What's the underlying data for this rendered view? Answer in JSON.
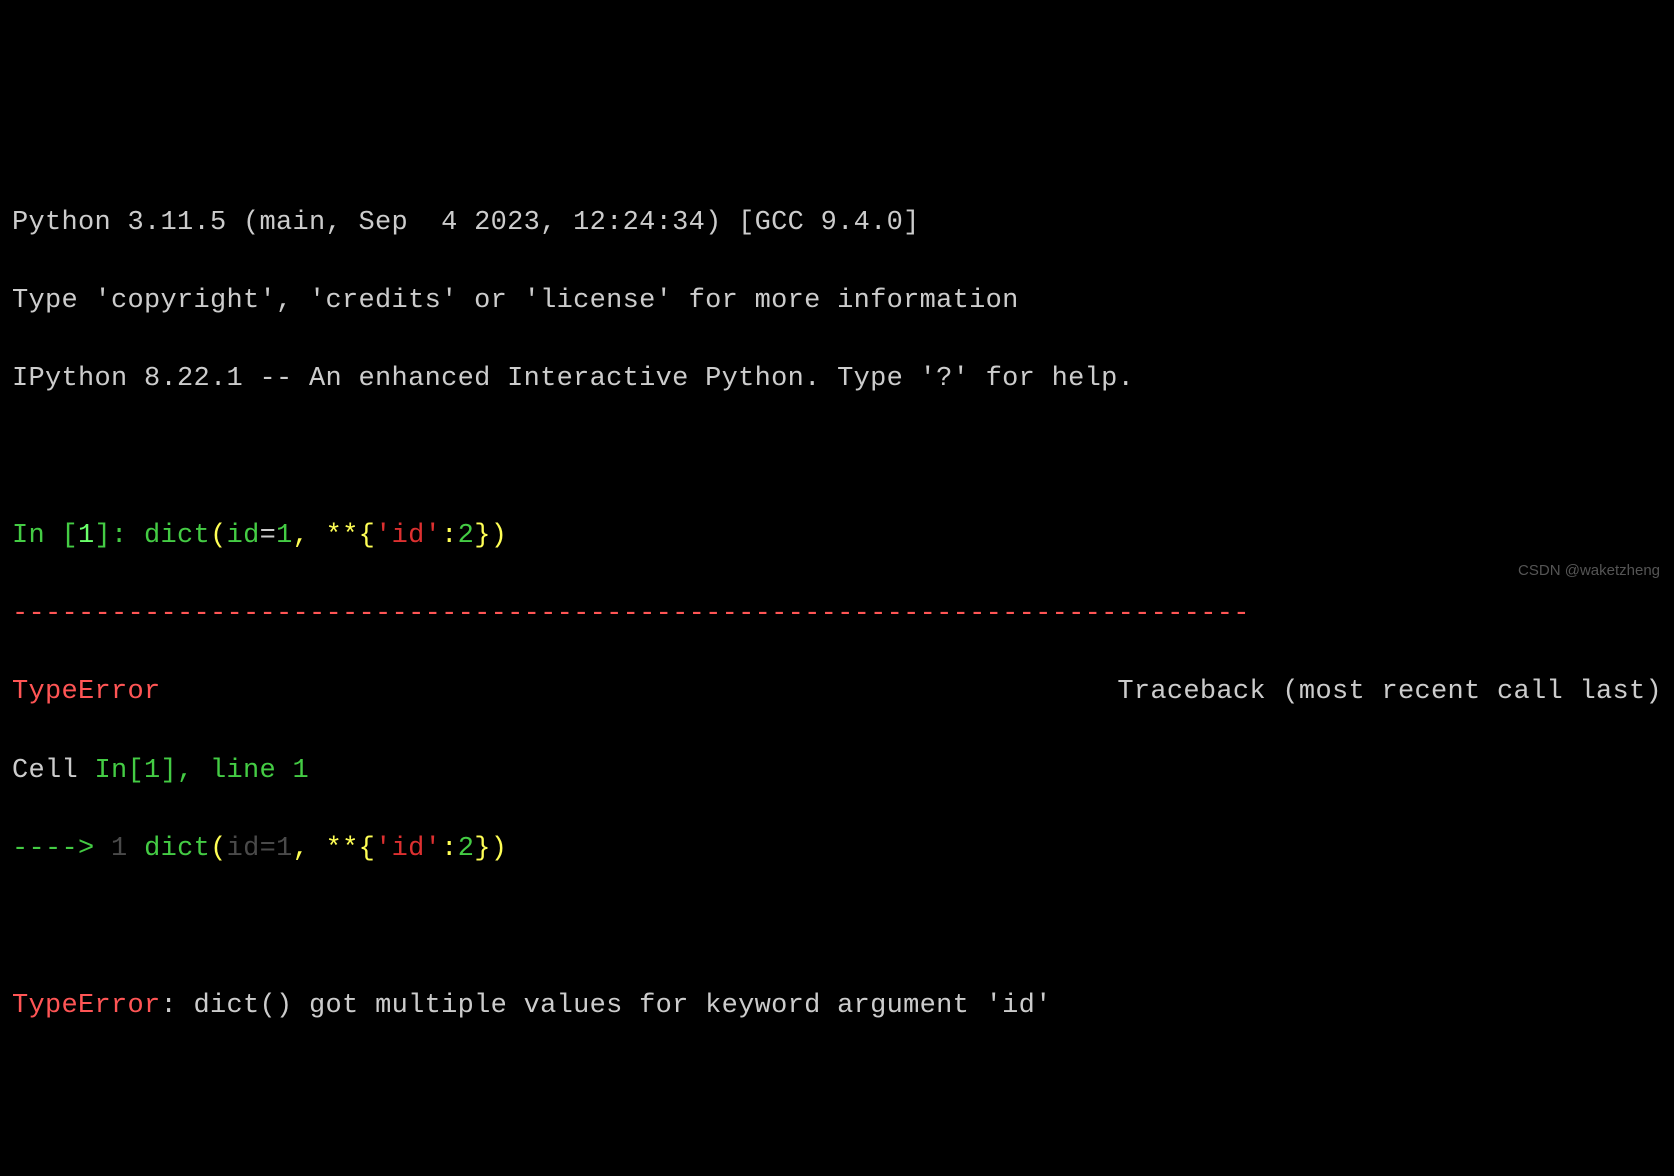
{
  "header": {
    "line1": "Python 3.11.5 (main, Sep  4 2023, 12:24:34) [GCC 9.4.0]",
    "line2": "Type 'copyright', 'credits' or 'license' for more information",
    "line3": "IPython 8.22.1 -- An enhanced Interactive Python. Type '?' for help."
  },
  "input": {
    "prompt_prefix": "In [",
    "prompt_num": "1",
    "prompt_suffix": "]: ",
    "cmd_func": "dict",
    "cmd_p1": "(",
    "cmd_id": "id",
    "cmd_eq": "=",
    "cmd_v1": "1",
    "cmd_sep": ", **{",
    "cmd_str": "'id'",
    "cmd_colon": ":",
    "cmd_v2": "2",
    "cmd_end": "})"
  },
  "traceback": {
    "dashes": "---------------------------------------------------------------------------",
    "error_type": "TypeError",
    "tb_label": "Traceback (most recent call last)",
    "cell": "Cell ",
    "cell_ref": "In[1]",
    "cell_line": ", line 1",
    "arrow": "----> ",
    "arrow_num": "1",
    "arrow_sp": " ",
    "code_func": "dict",
    "code_p1": "(",
    "code_id": "id",
    "code_eq": "=",
    "code_v1": "1",
    "code_sep": ", **{",
    "code_str": "'id'",
    "code_colon": ":",
    "code_v2": "2",
    "code_end": "})",
    "final_error": "TypeError",
    "final_msg": ": dict() got multiple values for keyword argument 'id'"
  },
  "watermark": "CSDN @waketzheng"
}
